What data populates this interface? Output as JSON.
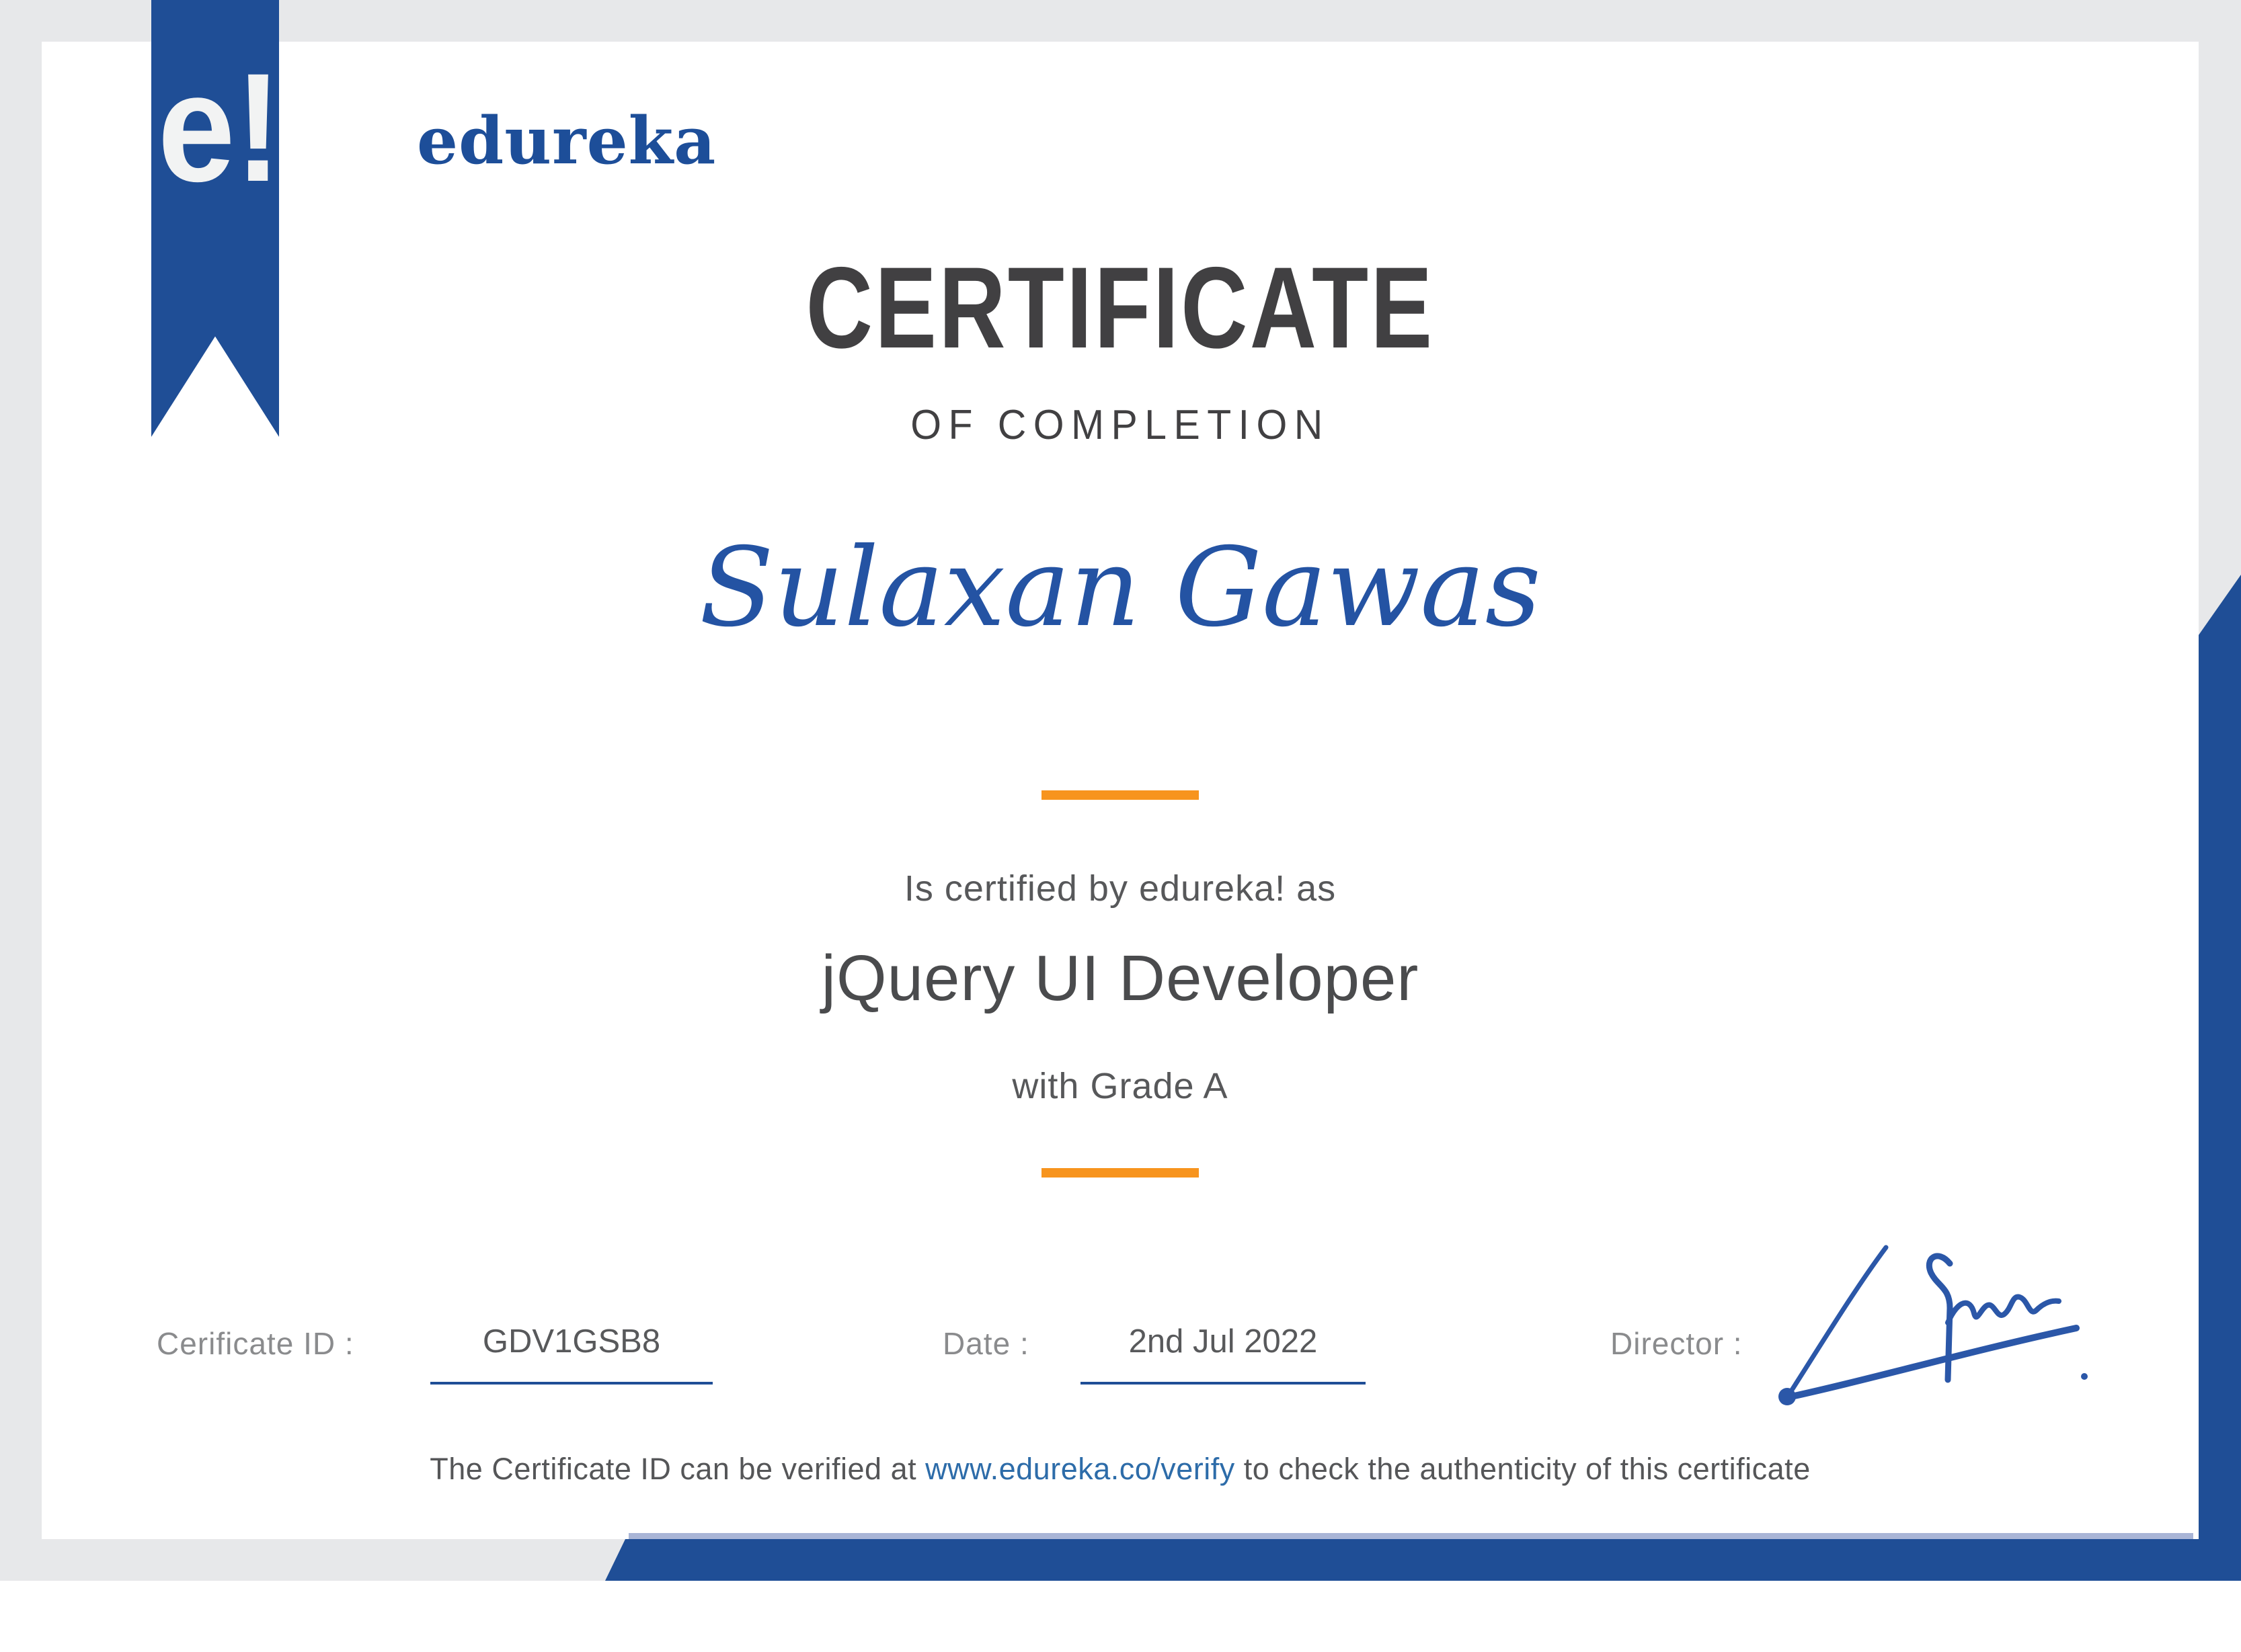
{
  "brand": {
    "monogram": "e!",
    "wordmark": "edureka"
  },
  "heading": {
    "title": "CERTIFICATE",
    "subtitle": "OF COMPLETION"
  },
  "recipient_name": "Sulaxan Gawas",
  "statement": {
    "certified_by": "Is certified by edureka! as",
    "course": "jQuery UI Developer",
    "grade": "with Grade A"
  },
  "fields": {
    "certificate_id": {
      "label": "Cerificate ID :",
      "value": "GDV1GSB8"
    },
    "date": {
      "label": "Date :",
      "value": "2nd Jul 2022"
    },
    "director": {
      "label": "Director :"
    }
  },
  "footer": {
    "text_before_link": "The Certificate ID can be verified at ",
    "link": "www.edureka.co/verify",
    "text_after_link": " to check the authenticity of this certificate"
  },
  "colors": {
    "brand_blue": "#1f4e96",
    "accent_orange": "#f7941e",
    "title_dark": "#414042",
    "body_gray": "#57585a",
    "label_gray": "#8a8b8d",
    "link_blue": "#2d6ca9",
    "frame_gray": "#e7e8ea",
    "band_highlight": "#a9b5d6",
    "signature_ink": "#2b57a8"
  }
}
